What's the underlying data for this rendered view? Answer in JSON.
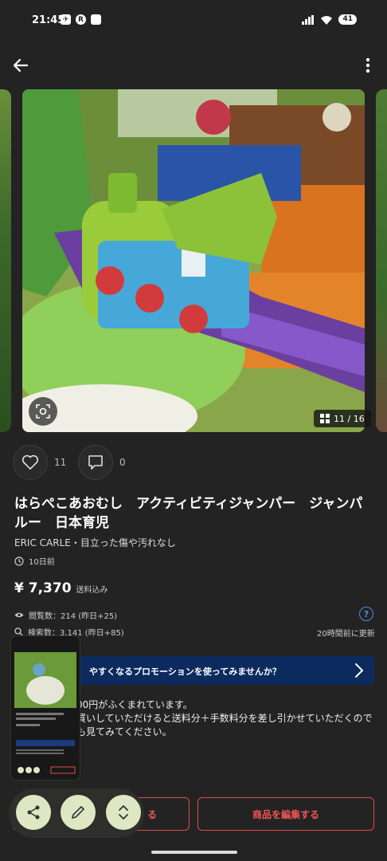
{
  "status_bar": {
    "time": "21:45",
    "battery": "41"
  },
  "gallery": {
    "counter": "11 / 16"
  },
  "actions": {
    "likes": "11",
    "comments": "0"
  },
  "item": {
    "title": "はらぺこあおむし　アクティビティジャンパー　ジャンパルー　日本育児",
    "subtitle": "ERIC CARLE・目立った傷や汚れなし",
    "posted": "10日前",
    "price": "¥ 7,370",
    "price_note": "送料込み"
  },
  "stats": {
    "views": "閲覧数：214 (昨日+25)",
    "searches": "検索数：3,141 (昨日+85)",
    "updated": "20時間前に更新",
    "help": "?"
  },
  "promo": {
    "text": "やすくなるプロモーションを使ってみませんか？"
  },
  "body": {
    "line1": "00円がふくまれています。",
    "line2": "買いしていただけると送料分＋手数料分を差し引かせていただくので",
    "line3": "も見てみてください。"
  },
  "buttons": {
    "left": "る",
    "edit": "商品を編集する"
  },
  "colors": {
    "accent_red": "#e24b4b",
    "promo_blue": "#0d2a5e",
    "fab": "#dfe6c3"
  }
}
